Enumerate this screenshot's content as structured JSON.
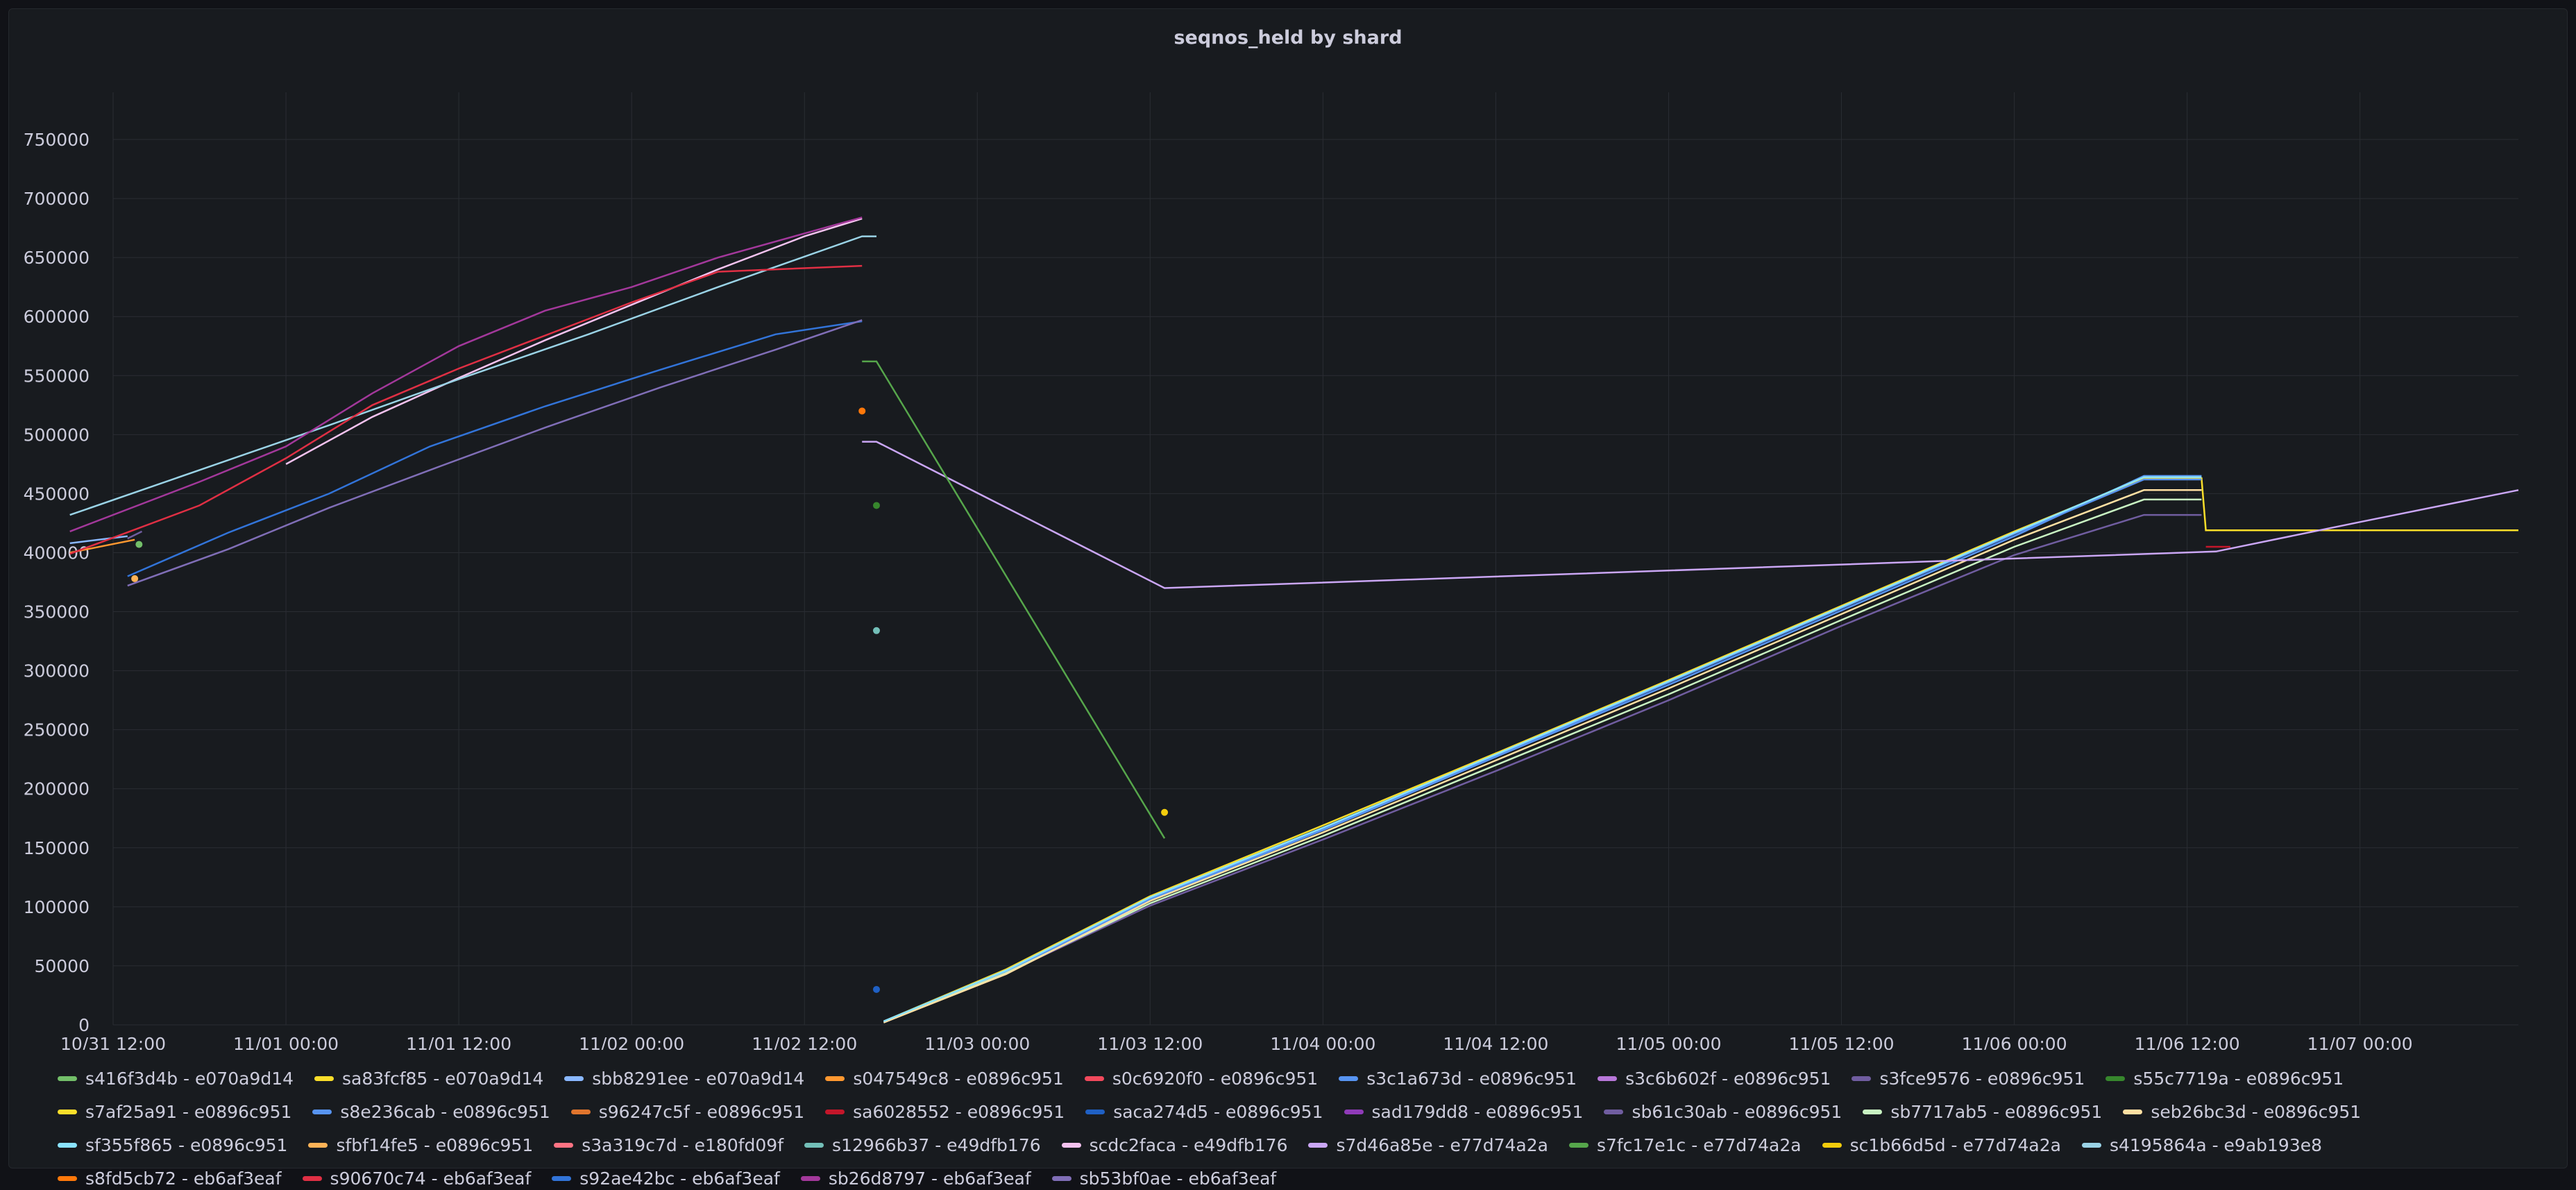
{
  "panel": {
    "title": "seqnos_held by shard"
  },
  "colors": {
    "background": "#181b1f",
    "grid": "#2a2d33",
    "text": "#ccccdc"
  },
  "chart_data": {
    "type": "line",
    "title": "seqnos_held by shard",
    "xlabel": "",
    "ylabel": "",
    "grid": true,
    "legend_position": "bottom",
    "x_ticks": [
      "10/31 12:00",
      "11/01 00:00",
      "11/01 12:00",
      "11/02 00:00",
      "11/02 12:00",
      "11/03 00:00",
      "11/03 12:00",
      "11/04 00:00",
      "11/04 12:00",
      "11/05 00:00",
      "11/05 12:00",
      "11/06 00:00",
      "11/06 12:00",
      "11/07 00:00"
    ],
    "x_range_hours": [
      0,
      167
    ],
    "y_ticks": [
      "0",
      "50000",
      "100000",
      "150000",
      "200000",
      "250000",
      "300000",
      "350000",
      "400000",
      "450000",
      "500000",
      "550000",
      "600000",
      "650000",
      "700000",
      "750000"
    ],
    "ylim": [
      0,
      790000
    ],
    "series": [
      {
        "name": "s416f3d4b - e070a9d14",
        "color": "#73bf69",
        "points": [
          [
            1.8,
            407000
          ]
        ]
      },
      {
        "name": "sa83fcf85 - e070a9d14",
        "color": "#fade2a",
        "points": []
      },
      {
        "name": "sbb8291ee - e070a9d14",
        "color": "#8ab8ff",
        "points": [
          [
            -3,
            408000
          ],
          [
            1,
            414000
          ]
        ]
      },
      {
        "name": "s047549c8 - e0896c951",
        "color": "#ff9830",
        "points": [
          [
            -3,
            400000
          ],
          [
            1.5,
            411000
          ]
        ]
      },
      {
        "name": "s0c6920f0 - e0896c951",
        "color": "#f2495c",
        "points": []
      },
      {
        "name": "s3c1a673d - e0896c951",
        "color": "#5794f2",
        "points": [
          [
            53.5,
            3000
          ],
          [
            62,
            45000
          ],
          [
            72,
            106000
          ],
          [
            84,
            165000
          ],
          [
            96,
            227000
          ],
          [
            108,
            288000
          ],
          [
            120,
            351000
          ],
          [
            132,
            414000
          ],
          [
            141,
            465000
          ],
          [
            145,
            465000
          ]
        ]
      },
      {
        "name": "s3c6b602f - e0896c951",
        "color": "#b877d9",
        "points": []
      },
      {
        "name": "s3fce9576 - e0896c951",
        "color": "#705da0",
        "points": [
          [
            1,
            412000
          ],
          [
            2,
            418000
          ]
        ]
      },
      {
        "name": "s55c7719a - e0896c951",
        "color": "#37872d",
        "points": [
          [
            53,
            440000
          ]
        ]
      },
      {
        "name": "s7af25a91 - e0896c951",
        "color": "#fade2a",
        "points": [
          [
            53.5,
            3000
          ],
          [
            62,
            47000
          ],
          [
            72,
            109000
          ],
          [
            84,
            169000
          ],
          [
            96,
            230000
          ],
          [
            108,
            292000
          ],
          [
            120,
            355000
          ],
          [
            132,
            418000
          ],
          [
            141,
            463000
          ],
          [
            145,
            463000
          ],
          [
            145.3,
            419000
          ],
          [
            167,
            419000
          ]
        ]
      },
      {
        "name": "s8e236cab - e0896c951",
        "color": "#5794f2",
        "points": [
          [
            53.5,
            3000
          ],
          [
            62,
            46000
          ],
          [
            72,
            107000
          ],
          [
            84,
            166000
          ],
          [
            96,
            228000
          ],
          [
            108,
            290000
          ],
          [
            120,
            353000
          ],
          [
            132,
            416000
          ],
          [
            141,
            462000
          ],
          [
            145,
            462000
          ]
        ]
      },
      {
        "name": "s96247c5f - e0896c951",
        "color": "#e0752d",
        "points": []
      },
      {
        "name": "sa6028552 - e0896c951",
        "color": "#c4162a",
        "points": [
          [
            145.3,
            405000
          ],
          [
            147,
            405000
          ]
        ]
      },
      {
        "name": "saca274d5 - e0896c951",
        "color": "#1f60c4",
        "points": [
          [
            53,
            30000
          ]
        ]
      },
      {
        "name": "sad179dd8 - e0896c951",
        "color": "#8f3bb8",
        "points": []
      },
      {
        "name": "sb61c30ab - e0896c951",
        "color": "#705da0",
        "points": [
          [
            53.5,
            2000
          ],
          [
            62,
            44000
          ],
          [
            72,
            101000
          ],
          [
            84,
            157000
          ],
          [
            96,
            215000
          ],
          [
            108,
            275000
          ],
          [
            120,
            338000
          ],
          [
            132,
            398000
          ],
          [
            141,
            432000
          ],
          [
            145,
            432000
          ]
        ]
      },
      {
        "name": "sb7717ab5 - e0896c951",
        "color": "#c8f2c2",
        "points": [
          [
            53.5,
            2000
          ],
          [
            62,
            44000
          ],
          [
            72,
            103000
          ],
          [
            84,
            160000
          ],
          [
            96,
            220000
          ],
          [
            108,
            280000
          ],
          [
            120,
            343000
          ],
          [
            132,
            405000
          ],
          [
            141,
            445000
          ],
          [
            145,
            445000
          ]
        ]
      },
      {
        "name": "seb26bc3d - e0896c951",
        "color": "#ffe0a3",
        "points": [
          [
            53.5,
            2000
          ],
          [
            62,
            43000
          ],
          [
            72,
            105000
          ],
          [
            84,
            163000
          ],
          [
            96,
            224000
          ],
          [
            108,
            285000
          ],
          [
            120,
            348000
          ],
          [
            132,
            411000
          ],
          [
            141,
            453000
          ],
          [
            145,
            453000
          ]
        ]
      },
      {
        "name": "sf355f865 - e0896c951",
        "color": "#8ae3ff",
        "points": [
          [
            53.5,
            3000
          ],
          [
            62,
            46000
          ],
          [
            72,
            108000
          ],
          [
            84,
            167000
          ],
          [
            96,
            229000
          ],
          [
            108,
            291000
          ],
          [
            120,
            354000
          ],
          [
            132,
            417000
          ],
          [
            141,
            464000
          ],
          [
            145,
            464000
          ]
        ]
      },
      {
        "name": "sfbf14fe5 - e0896c951",
        "color": "#ffb357",
        "points": [
          [
            1.5,
            378000
          ]
        ]
      },
      {
        "name": "s3a319c7d - e180fd09f",
        "color": "#ff7383",
        "points": []
      },
      {
        "name": "s12966b37 - e49dfb176",
        "color": "#73bfb8",
        "points": [
          [
            53,
            334000
          ]
        ]
      },
      {
        "name": "scdc2faca - e49dfb176",
        "color": "#f4c2ef",
        "points": [
          [
            12,
            475000
          ],
          [
            18,
            515000
          ],
          [
            24,
            548000
          ],
          [
            30,
            580000
          ],
          [
            36,
            610000
          ],
          [
            42,
            640000
          ],
          [
            48,
            668000
          ],
          [
            52,
            683000
          ]
        ]
      },
      {
        "name": "s7d46a85e - e77d74a2a",
        "color": "#caa6f5",
        "points": [
          [
            52,
            494000
          ],
          [
            53,
            494000
          ],
          [
            73,
            370000
          ],
          [
            146,
            401000
          ],
          [
            156,
            426000
          ],
          [
            167,
            453000
          ]
        ]
      },
      {
        "name": "s7fc17e1c - e77d74a2a",
        "color": "#56a64b",
        "points": [
          [
            52,
            562000
          ],
          [
            53,
            562000
          ],
          [
            73,
            158000
          ]
        ]
      },
      {
        "name": "sc1b66d5d - e77d74a2a",
        "color": "#f2cc0c",
        "points": [
          [
            73,
            180000
          ]
        ]
      },
      {
        "name": "s4195864a - e9ab193e8",
        "color": "#9ad3e6",
        "points": [
          [
            -3,
            432000
          ],
          [
            6,
            470000
          ],
          [
            15,
            508000
          ],
          [
            24,
            547000
          ],
          [
            33,
            585000
          ],
          [
            42,
            625000
          ],
          [
            52,
            668000
          ],
          [
            53,
            668000
          ]
        ]
      },
      {
        "name": "s8fd5cb72 - eb6af3eaf",
        "color": "#ff780a",
        "points": [
          [
            52,
            520000
          ]
        ]
      },
      {
        "name": "s90670c74 - eb6af3eaf",
        "color": "#e02f44",
        "points": [
          [
            -3,
            399000
          ],
          [
            6,
            440000
          ],
          [
            12,
            480000
          ],
          [
            18,
            525000
          ],
          [
            24,
            556000
          ],
          [
            30,
            584000
          ],
          [
            36,
            612000
          ],
          [
            42,
            638000
          ],
          [
            52,
            643000
          ]
        ]
      },
      {
        "name": "s92ae42bc - eb6af3eaf",
        "color": "#3274d9",
        "points": [
          [
            1,
            380000
          ],
          [
            8,
            417000
          ],
          [
            15,
            450000
          ],
          [
            22,
            490000
          ],
          [
            30,
            524000
          ],
          [
            38,
            555000
          ],
          [
            46,
            585000
          ],
          [
            52,
            596000
          ]
        ]
      },
      {
        "name": "sb26d8797 - eb6af3eaf",
        "color": "#a3389b",
        "points": [
          [
            -3,
            418000
          ],
          [
            6,
            460000
          ],
          [
            12,
            490000
          ],
          [
            18,
            535000
          ],
          [
            24,
            575000
          ],
          [
            30,
            605000
          ],
          [
            36,
            625000
          ],
          [
            42,
            650000
          ],
          [
            52,
            684000
          ]
        ]
      },
      {
        "name": "sb53bf0ae - eb6af3eaf",
        "color": "#806eb7",
        "points": [
          [
            1,
            372000
          ],
          [
            8,
            403000
          ],
          [
            15,
            438000
          ],
          [
            22,
            470000
          ],
          [
            30,
            506000
          ],
          [
            38,
            540000
          ],
          [
            46,
            572000
          ],
          [
            52,
            597000
          ]
        ]
      }
    ]
  }
}
